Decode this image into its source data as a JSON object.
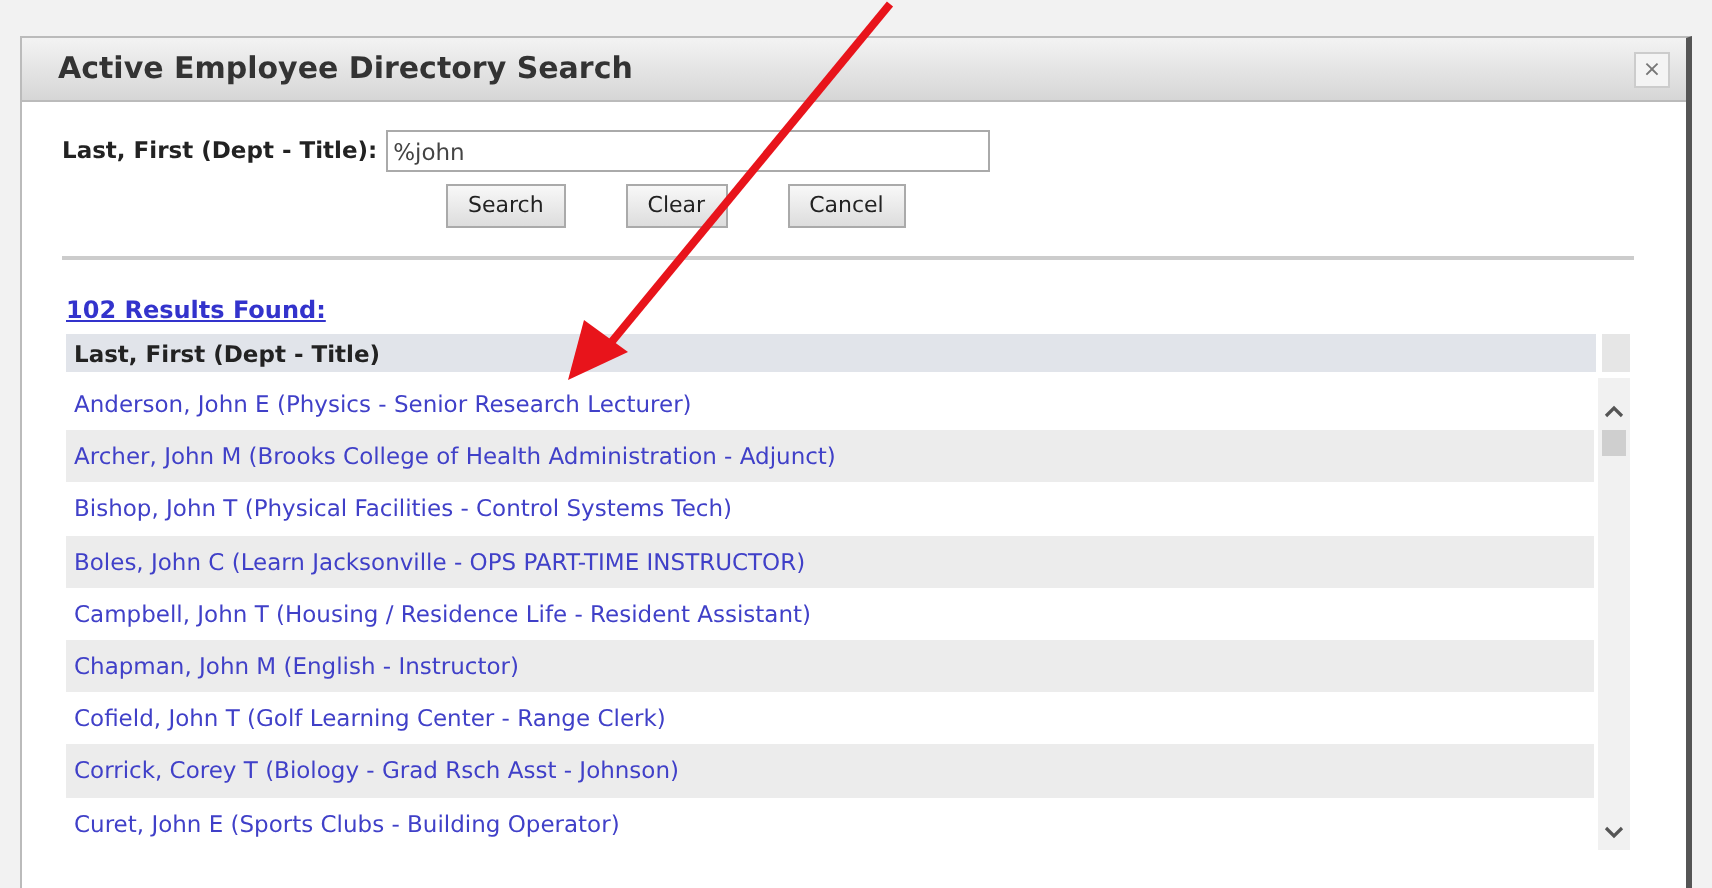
{
  "dialog": {
    "title": "Active Employee Directory Search",
    "close": "×"
  },
  "search": {
    "label": "Last, First (Dept - Title):",
    "value": "%john"
  },
  "buttons": [
    "Search",
    "Clear",
    "Cancel"
  ],
  "results": {
    "count": "102 Results Found:",
    "column": "Last, First (Dept - Title)",
    "rows": [
      "Anderson, John E (Physics - Senior Research Lecturer)",
      "Archer, John M (Brooks College of Health Administration - Adjunct)",
      "Bishop, John T (Physical Facilities - Control Systems Tech)",
      "Boles, John C (Learn Jacksonville - OPS PART-TIME INSTRUCTOR)",
      "Campbell, John T (Housing / Residence Life - Resident Assistant)",
      "Chapman, John M (English - Instructor)",
      "Cofield, John T (Golf Learning Center - Range Clerk)",
      "Corrick, Corey T (Biology - Grad Rsch Asst - Johnson)",
      "Curet, John E (Sports Clubs - Building Operator)"
    ]
  }
}
